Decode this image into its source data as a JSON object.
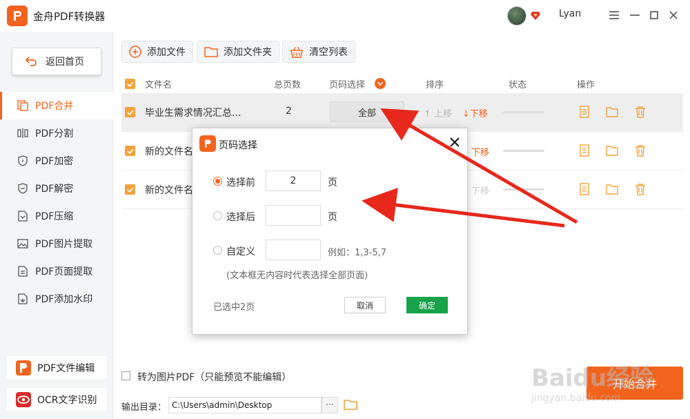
{
  "app": {
    "title": "金舟PDF转换器",
    "username": "Lyan",
    "accent": "#f2641e"
  },
  "sidebar": {
    "home_label": "返回首页",
    "items": [
      {
        "label": "PDF合并",
        "icon": "merge-icon",
        "active": true
      },
      {
        "label": "PDF分割",
        "icon": "split-icon"
      },
      {
        "label": "PDF加密",
        "icon": "shield-lock-icon"
      },
      {
        "label": "PDF解密",
        "icon": "shield-unlock-icon"
      },
      {
        "label": "PDF压缩",
        "icon": "compress-icon"
      },
      {
        "label": "PDF图片提取",
        "icon": "image-icon"
      },
      {
        "label": "PDF页面提取",
        "icon": "page-icon"
      },
      {
        "label": "PDF添加水印",
        "icon": "watermark-icon"
      }
    ],
    "bottom": [
      {
        "label": "PDF文件编辑",
        "icon": "pdf-edit-icon"
      },
      {
        "label": "OCR文字识别",
        "icon": "ocr-icon"
      }
    ]
  },
  "toolbar": {
    "add_file": "添加文件",
    "add_folder": "添加文件夹",
    "clear_list": "清空列表"
  },
  "table": {
    "headers": {
      "name": "文件名",
      "pages": "总页数",
      "page_select": "页码选择",
      "order": "排序",
      "status": "状态",
      "ops": "操作"
    },
    "rows": [
      {
        "name": "毕业生需求情况汇总...",
        "pages": "2",
        "page_select": "全部",
        "up": "上移",
        "down": "下移"
      },
      {
        "name": "新的文件名",
        "pages": "",
        "page_select": "",
        "up": "",
        "down": "下移"
      },
      {
        "name": "新的文件名",
        "pages": "",
        "page_select": "",
        "up": "",
        "down": "下移"
      }
    ]
  },
  "dialog": {
    "title": "页码选择",
    "opt_before": "选择前",
    "opt_after": "选择后",
    "opt_custom": "自定义",
    "before_value": "2",
    "unit": "页",
    "example": "例如：1,3-5,7",
    "note": "(文本框无内容时代表选择全部页面)",
    "selected_info": "已选中2页",
    "cancel": "取消",
    "ok": "确定"
  },
  "footer": {
    "to_image_label": "转为图片PDF（只能预览不能编辑）",
    "output_label": "输出目录：",
    "output_path": "C:\\Users\\admin\\Desktop",
    "more": "···",
    "start": "开始合并"
  },
  "watermark": {
    "line1": "Baidu经验",
    "line2": "jingyan.baidu.com"
  }
}
